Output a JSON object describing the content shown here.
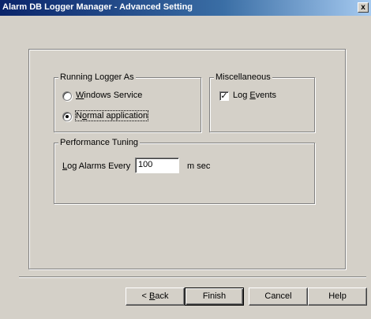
{
  "window": {
    "title": "Alarm DB Logger Manager - Advanced Setting",
    "close_glyph": "x"
  },
  "running_logger": {
    "label": "Running Logger As",
    "options": [
      {
        "pre": "",
        "mnemonic": "W",
        "post": "indows Service",
        "selected": false
      },
      {
        "pre": "N",
        "mnemonic": "o",
        "post": "rmal application",
        "selected": true
      }
    ]
  },
  "misc": {
    "label": "Miscellaneous",
    "log_events": {
      "pre": "Log ",
      "mnemonic": "E",
      "post": "vents",
      "checked": true,
      "check_glyph": "✓"
    }
  },
  "performance": {
    "label": "Performance Tuning",
    "field": {
      "pre": "",
      "mnemonic": "L",
      "post": "og Alarms Every",
      "value": "100",
      "unit": "m sec"
    }
  },
  "buttons": {
    "back": {
      "pre": "< ",
      "mnemonic": "B",
      "post": "ack"
    },
    "finish": "Finish",
    "cancel": "Cancel",
    "help": "Help"
  }
}
